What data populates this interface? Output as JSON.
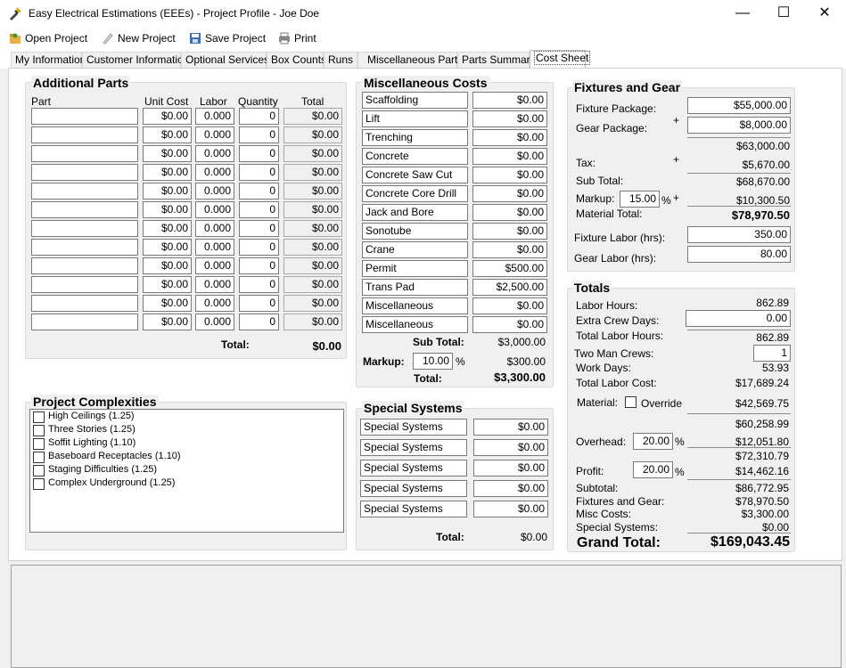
{
  "window": {
    "title": "Easy Electrical Estimations (EEEs) - Project Profile - Joe Doe",
    "minimize": "—",
    "maximize": "☐",
    "close": "✕"
  },
  "toolbar": {
    "open_project": "Open Project",
    "new_project": "New Project",
    "save_project": "Save Project",
    "print": "Print"
  },
  "tabs": [
    "My Information",
    "Customer Information",
    "Optional Services",
    "Box Counts",
    "Runs",
    "Miscellaneous Parts",
    "Parts Summary",
    "Cost Sheet"
  ],
  "active_tab": "Cost Sheet",
  "additional_parts": {
    "title": "Additional Parts",
    "headers": {
      "part": "Part",
      "unit_cost": "Unit Cost",
      "labor": "Labor",
      "quantity": "Quantity",
      "total": "Total"
    },
    "rows": [
      {
        "part": "",
        "unit_cost": "$0.00",
        "labor": "0.000",
        "quantity": "0",
        "total": "$0.00"
      },
      {
        "part": "",
        "unit_cost": "$0.00",
        "labor": "0.000",
        "quantity": "0",
        "total": "$0.00"
      },
      {
        "part": "",
        "unit_cost": "$0.00",
        "labor": "0.000",
        "quantity": "0",
        "total": "$0.00"
      },
      {
        "part": "",
        "unit_cost": "$0.00",
        "labor": "0.000",
        "quantity": "0",
        "total": "$0.00"
      },
      {
        "part": "",
        "unit_cost": "$0.00",
        "labor": "0.000",
        "quantity": "0",
        "total": "$0.00"
      },
      {
        "part": "",
        "unit_cost": "$0.00",
        "labor": "0.000",
        "quantity": "0",
        "total": "$0.00"
      },
      {
        "part": "",
        "unit_cost": "$0.00",
        "labor": "0.000",
        "quantity": "0",
        "total": "$0.00"
      },
      {
        "part": "",
        "unit_cost": "$0.00",
        "labor": "0.000",
        "quantity": "0",
        "total": "$0.00"
      },
      {
        "part": "",
        "unit_cost": "$0.00",
        "labor": "0.000",
        "quantity": "0",
        "total": "$0.00"
      },
      {
        "part": "",
        "unit_cost": "$0.00",
        "labor": "0.000",
        "quantity": "0",
        "total": "$0.00"
      },
      {
        "part": "",
        "unit_cost": "$0.00",
        "labor": "0.000",
        "quantity": "0",
        "total": "$0.00"
      },
      {
        "part": "",
        "unit_cost": "$0.00",
        "labor": "0.000",
        "quantity": "0",
        "total": "$0.00"
      }
    ],
    "total_label": "Total:",
    "total_value": "$0.00"
  },
  "misc_costs": {
    "title": "Miscellaneous Costs",
    "rows": [
      {
        "name": "Scaffolding",
        "value": "$0.00"
      },
      {
        "name": "Lift",
        "value": "$0.00"
      },
      {
        "name": "Trenching",
        "value": "$0.00"
      },
      {
        "name": "Concrete",
        "value": "$0.00"
      },
      {
        "name": "Concrete Saw Cut",
        "value": "$0.00"
      },
      {
        "name": "Concrete Core Drill",
        "value": "$0.00"
      },
      {
        "name": "Jack and Bore",
        "value": "$0.00"
      },
      {
        "name": "Sonotube",
        "value": "$0.00"
      },
      {
        "name": "Crane",
        "value": "$0.00"
      },
      {
        "name": "Permit",
        "value": "$500.00"
      },
      {
        "name": "Trans Pad",
        "value": "$2,500.00"
      },
      {
        "name": "Miscellaneous",
        "value": "$0.00"
      },
      {
        "name": "Miscellaneous",
        "value": "$0.00"
      }
    ],
    "subtotal_label": "Sub Total:",
    "subtotal_value": "$3,000.00",
    "markup_label": "Markup:",
    "markup_value": "10.00",
    "markup_pct": "%",
    "markup_amount": "$300.00",
    "total_label": "Total:",
    "total_value": "$3,300.00"
  },
  "special_systems": {
    "title": "Special Systems",
    "rows": [
      {
        "name": "Special Systems",
        "value": "$0.00"
      },
      {
        "name": "Special Systems",
        "value": "$0.00"
      },
      {
        "name": "Special Systems",
        "value": "$0.00"
      },
      {
        "name": "Special Systems",
        "value": "$0.00"
      },
      {
        "name": "Special Systems",
        "value": "$0.00"
      }
    ],
    "total_label": "Total:",
    "total_value": "$0.00"
  },
  "complexities": {
    "title": "Project Complexities",
    "items": [
      "High Ceilings (1.25)",
      "Three Stories (1.25)",
      "Soffit Lighting (1.10)",
      "Baseboard Receptacles (1.10)",
      "Staging Difficulties (1.25)",
      "Complex Underground (1.25)"
    ]
  },
  "fixtures": {
    "title": "Fixtures and Gear",
    "fixture_package_label": "Fixture Package:",
    "fixture_package_value": "$55,000.00",
    "gear_package_label": "Gear Package:",
    "gear_package_value": "$8,000.00",
    "plus": "+",
    "packages_total": "$63,000.00",
    "tax_label": "Tax:",
    "tax_value": "$5,670.00",
    "subtotal_label": "Sub Total:",
    "subtotal_value": "$68,670.00",
    "markup_label": "Markup:",
    "markup_value": "15.00",
    "markup_pct": "%",
    "markup_amount": "$10,300.50",
    "material_total_label": "Material Total:",
    "material_total_value": "$78,970.50",
    "fixture_labor_label": "Fixture Labor (hrs):",
    "fixture_labor_value": "350.00",
    "gear_labor_label": "Gear Labor (hrs):",
    "gear_labor_value": "80.00"
  },
  "totals": {
    "title": "Totals",
    "labor_hours_label": "Labor Hours:",
    "labor_hours_value": "862.89",
    "extra_crew_label": "Extra Crew Days:",
    "extra_crew_value": "0.00",
    "total_labor_hours_label": "Total Labor Hours:",
    "total_labor_hours_value": "862.89",
    "two_man_label": "Two Man Crews:",
    "two_man_value": "1",
    "work_days_label": "Work Days:",
    "work_days_value": "53.93",
    "total_labor_cost_label": "Total Labor Cost:",
    "total_labor_cost_value": "$17,689.24",
    "material_label": "Material:",
    "override_label": "Override",
    "material_value": "$42,569.75",
    "sum1": "$60,258.99",
    "overhead_label": "Overhead:",
    "overhead_value": "20.00",
    "overhead_pct": "%",
    "overhead_amount": "$12,051.80",
    "sum2": "$72,310.79",
    "profit_label": "Profit:",
    "profit_value": "20.00",
    "profit_pct": "%",
    "profit_amount": "$14,462.16",
    "subtotal_label": "Subtotal:",
    "subtotal_value": "$86,772.95",
    "fixtures_gear_label": "Fixtures and Gear:",
    "fixtures_gear_value": "$78,970.50",
    "misc_costs_label": "Misc Costs:",
    "misc_costs_value": "$3,300.00",
    "special_systems_label": "Special Systems:",
    "special_systems_value": "$0.00",
    "grand_total_label": "Grand Total:",
    "grand_total_value": "$169,043.45"
  }
}
